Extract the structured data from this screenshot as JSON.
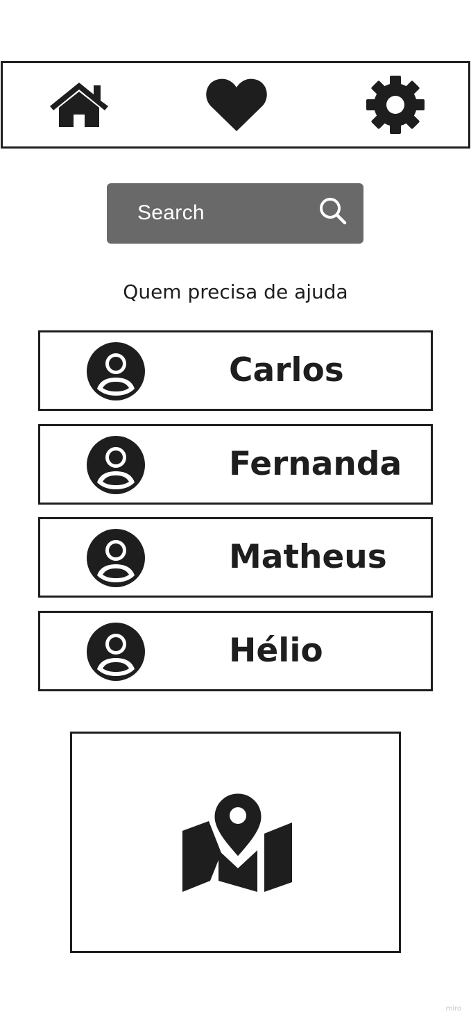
{
  "nav": {
    "items": [
      {
        "icon": "home-icon"
      },
      {
        "icon": "heart-icon"
      },
      {
        "icon": "gear-icon"
      }
    ]
  },
  "search": {
    "placeholder": "Search",
    "icon": "search-icon"
  },
  "section_title": "Quem precisa de ajuda",
  "people": [
    {
      "name": "Carlos",
      "icon": "user-avatar-icon"
    },
    {
      "name": "Fernanda",
      "icon": "user-avatar-icon"
    },
    {
      "name": "Matheus",
      "icon": "user-avatar-icon"
    },
    {
      "name": "Hélio",
      "icon": "user-avatar-icon"
    }
  ],
  "map": {
    "icon": "map-pin-icon"
  },
  "watermark": "miro",
  "colors": {
    "ink": "#1e1e1e",
    "search_bg": "#696969",
    "search_text": "#ffffff",
    "background": "#ffffff"
  }
}
